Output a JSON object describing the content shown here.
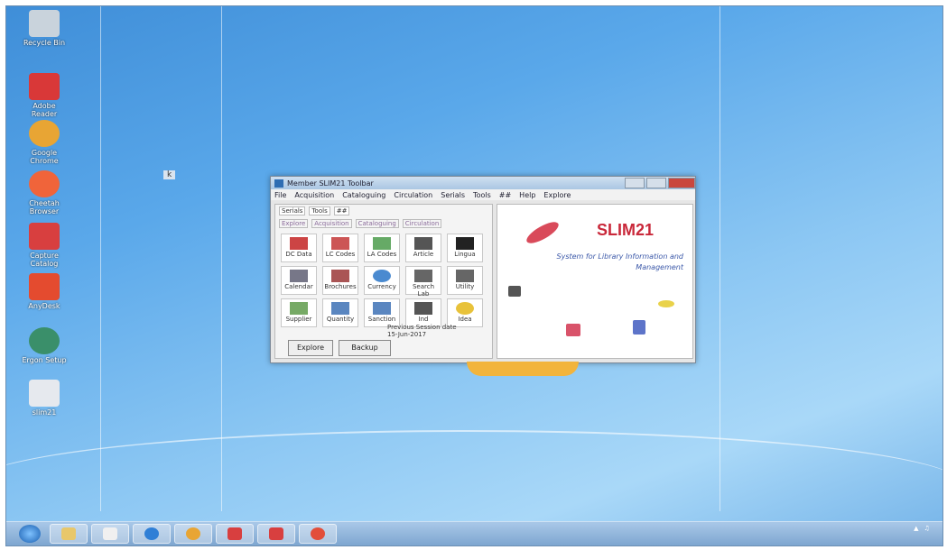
{
  "desktop": {
    "icons": [
      {
        "label": "Recycle Bin",
        "color": "#c9d3dc"
      },
      {
        "label": "Adobe Reader",
        "color": "#d93838"
      },
      {
        "label": "Google Chrome",
        "color": "#e8a534"
      },
      {
        "label": "Cheetah Browser",
        "color": "#f0643a"
      },
      {
        "label": "Capture Catalog",
        "color": "#d83f3f"
      },
      {
        "label": "AnyDesk",
        "color": "#e44b2f"
      },
      {
        "label": "Ergon Setup",
        "color": "#3a8f6a"
      },
      {
        "label": "slim21",
        "color": "#e6e9ee"
      }
    ],
    "cursor_label": "k"
  },
  "window": {
    "title": "Member SLIM21 Toolbar",
    "menu": [
      "File",
      "Acquisition",
      "Cataloguing",
      "Circulation",
      "Serials",
      "Tools",
      "##",
      "Help",
      "Explore"
    ],
    "tabs": [
      "Serials",
      "Tools",
      "##"
    ],
    "subtabs": [
      "Explore",
      "Acquisition",
      "Cataloguing",
      "Circulation"
    ],
    "tiles": [
      "DC Data",
      "LC Codes",
      "LA Codes",
      "Article",
      "Lingua",
      "Calendar",
      "Brochures",
      "Currency",
      "Search Lab",
      "Utility",
      "Supplier",
      "Quantity",
      "Sanction",
      "Ind",
      "Idea"
    ],
    "previous_text": "Previous Session date",
    "previous_date": "15-Jun-2017",
    "buttons": {
      "first": "Explore",
      "second": "Backup"
    },
    "brand": "SLIM21",
    "brand_sub": "System for Library Information and Management"
  },
  "taskbar": {
    "apps": [
      {
        "name": "explorer",
        "color": "#e8c76a"
      },
      {
        "name": "media",
        "color": "#f0f0f0"
      },
      {
        "name": "ie",
        "color": "#2f7fd6"
      },
      {
        "name": "chrome",
        "color": "#e8a534"
      },
      {
        "name": "app1",
        "color": "#d83f3f"
      },
      {
        "name": "app2",
        "color": "#d83f3f"
      },
      {
        "name": "app3",
        "color": "#e24e3a"
      }
    ]
  }
}
